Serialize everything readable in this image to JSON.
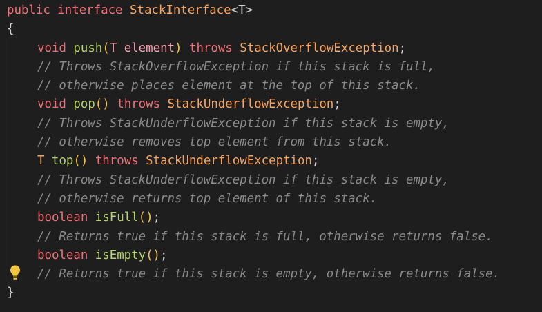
{
  "editor": {
    "lines": {
      "l1": {
        "kw": "public interface ",
        "name": "StackInterface",
        "open": "<",
        "type": "T",
        "close": ">"
      },
      "l2": {
        "brace": "{"
      },
      "l3": {
        "ret": "void",
        "sp": " ",
        "fn": "push",
        "p1": "(",
        "ptype": "T",
        "sp2": " ",
        "pname": "element",
        "p2": ")",
        "throws": " throws ",
        "exc": "StackOverflowException",
        "semi": ";"
      },
      "l4": {
        "comment": "// Throws StackOverflowException if this stack is full,"
      },
      "l5": {
        "comment": "// otherwise places element at the top of this stack."
      },
      "l6": {
        "ret": "void",
        "sp": " ",
        "fn": "pop",
        "parens": "()",
        "throws": " throws ",
        "exc": "StackUnderflowException",
        "semi": ";"
      },
      "l7": {
        "comment": "// Throws StackUnderflowException if this stack is empty,"
      },
      "l8": {
        "comment": "// otherwise removes top element from this stack."
      },
      "l9": {
        "ret": "T",
        "sp": " ",
        "fn": "top",
        "parens": "()",
        "throws": " throws ",
        "exc": "StackUnderflowException",
        "semi": ";"
      },
      "l10": {
        "comment": "// Throws StackUnderflowException if this stack is empty,"
      },
      "l11": {
        "comment": "// otherwise returns top element of this stack."
      },
      "l12": {
        "ret": "boolean",
        "sp": " ",
        "fn": "isFull",
        "parens": "()",
        "semi": ";"
      },
      "l13": {
        "comment": "// Returns true if this stack is full, otherwise returns false."
      },
      "l14": {
        "ret": "boolean",
        "sp": " ",
        "fn": "isEmpty",
        "parens": "()",
        "semi": ";"
      },
      "l15": {
        "comment": "// Returns true if this stack is empty, otherwise returns false."
      },
      "l16": {
        "brace": "}"
      }
    },
    "icons": {
      "lightbulb": "lightbulb-icon"
    },
    "colors": {
      "background": "#1e1e1e",
      "keyword": "#f07178",
      "function": "#b5d36a",
      "type": "#f9a35b",
      "parameter": "#f6a4b5",
      "comment": "#8a8a8a",
      "paren": "#f5c542",
      "lightbulb": "#f5c542"
    }
  }
}
